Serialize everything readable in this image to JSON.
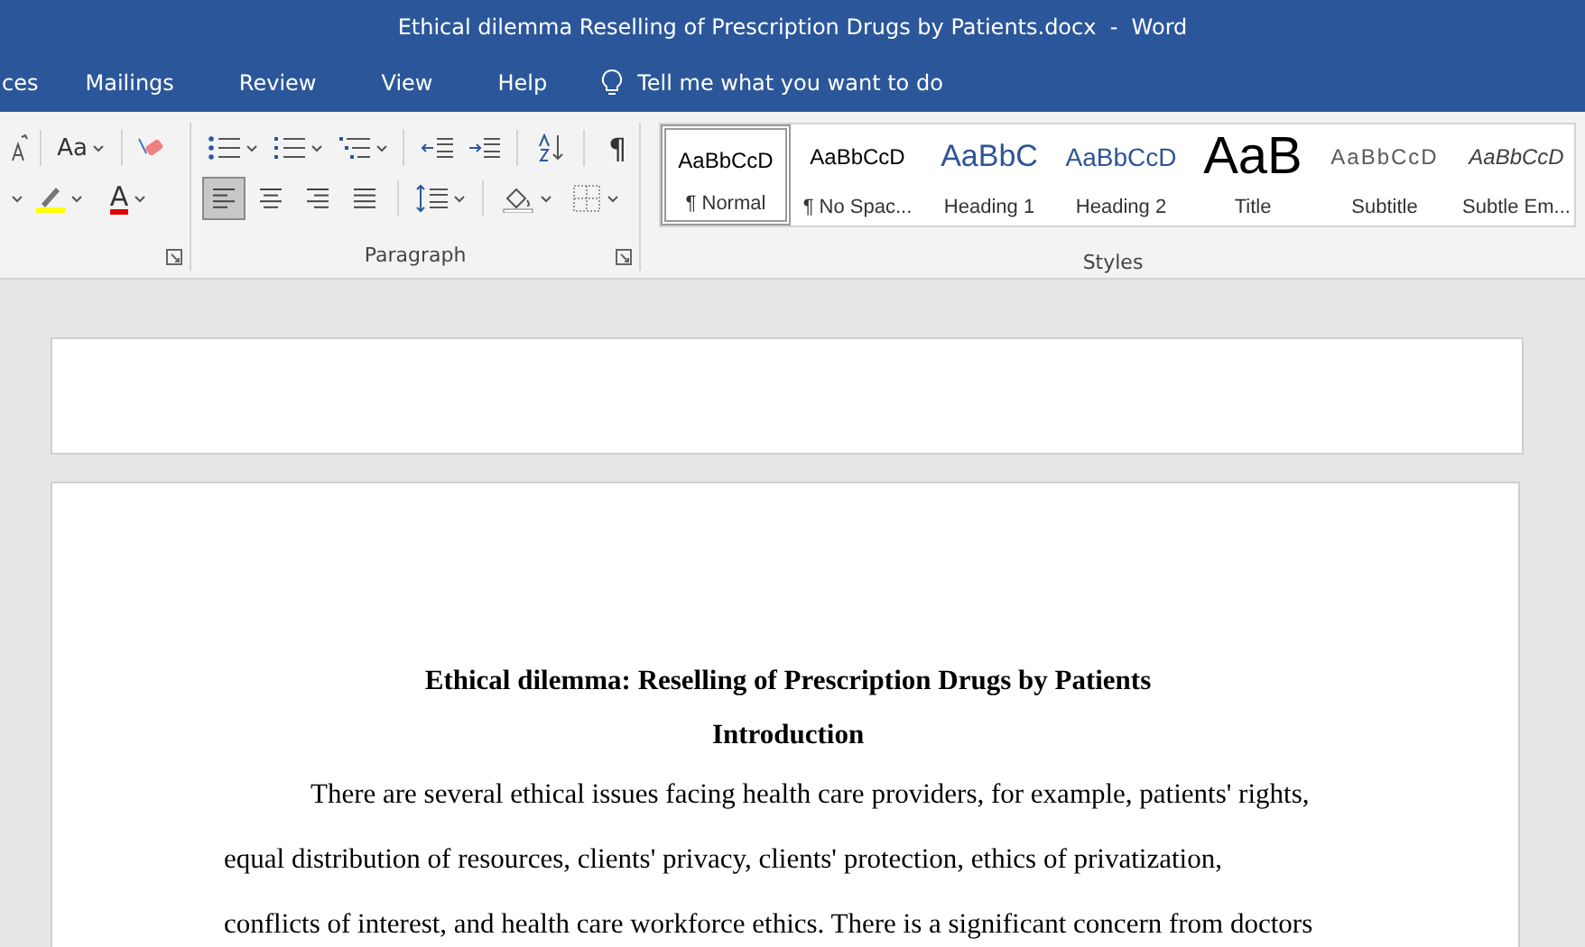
{
  "window": {
    "title": "Ethical dilemma Reselling of Prescription Drugs by Patients.docx  -  Word"
  },
  "tabs": [
    {
      "label": "ces",
      "selected": false
    },
    {
      "label": "Mailings",
      "selected": false
    },
    {
      "label": "Review",
      "selected": false
    },
    {
      "label": "View",
      "selected": false
    },
    {
      "label": "Help",
      "selected": false
    }
  ],
  "tell_me": {
    "placeholder": "Tell me what you want to do"
  },
  "font_group": {
    "change_case": "Aa",
    "font_color": "A"
  },
  "paragraph_group": {
    "label": "Paragraph",
    "show_marks": "¶",
    "alignment": [
      {
        "kind": "left",
        "selected": true
      },
      {
        "kind": "center",
        "selected": false
      },
      {
        "kind": "right",
        "selected": false
      },
      {
        "kind": "justify",
        "selected": false
      }
    ]
  },
  "styles_group": {
    "label": "Styles",
    "styles": [
      {
        "kind": "normal",
        "preview": "AaBbCcD",
        "label": "¶ Normal",
        "selected": true
      },
      {
        "kind": "normal",
        "preview": "AaBbCcD",
        "label": "¶ No Spac...",
        "selected": false
      },
      {
        "kind": "heading1",
        "preview": "AaBbC",
        "label": "Heading 1",
        "selected": false
      },
      {
        "kind": "heading2",
        "preview": "AaBbCcD",
        "label": "Heading 2",
        "selected": false
      },
      {
        "kind": "title",
        "preview": "AaB",
        "label": "Title",
        "selected": false
      },
      {
        "kind": "subtitle",
        "preview": "AaBbCcD",
        "label": "Subtitle",
        "selected": false
      },
      {
        "kind": "subtle",
        "preview": "AaBbCcD",
        "label": "Subtle Em...",
        "selected": false
      }
    ]
  },
  "document": {
    "title": "Ethical dilemma: Reselling of Prescription Drugs by Patients",
    "heading": "Introduction",
    "lines": [
      "There are several ethical issues facing health care providers, for example, patients' rights,",
      "equal distribution of resources, clients' privacy, clients' protection, ethics of privatization,",
      "conflicts of interest, and health care workforce ethics. There is a significant concern from doctors"
    ]
  }
}
